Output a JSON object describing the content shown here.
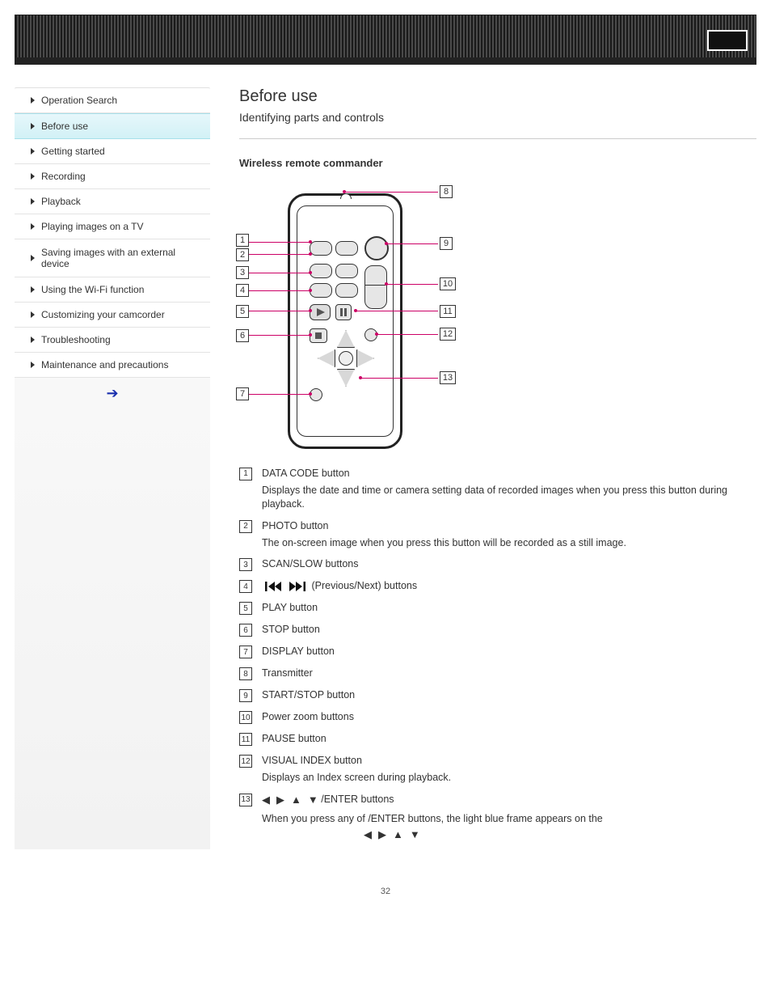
{
  "header": {
    "title": ""
  },
  "sidebar": {
    "items": [
      {
        "label": "Operation Search"
      },
      {
        "label": "Before use"
      },
      {
        "label": "Getting started"
      },
      {
        "label": "Recording"
      },
      {
        "label": "Playback"
      },
      {
        "label": "Playing images on a TV"
      },
      {
        "label": "Saving images with an external device"
      },
      {
        "label": "Using the Wi-Fi function"
      },
      {
        "label": "Customizing your camcorder"
      },
      {
        "label": "Troubleshooting"
      },
      {
        "label": "Maintenance and precautions"
      }
    ],
    "selected_index": 1
  },
  "main": {
    "title": "Before use",
    "subtitle": "Identifying parts and controls",
    "section": "Wireless remote commander",
    "items": {
      "1": {
        "text": "DATA CODE button",
        "note": "Displays the date and time or camera setting data of recorded images when you press this button during playback."
      },
      "2": {
        "text": "PHOTO button",
        "note": "The on-screen image when you press this button will be recorded as a still image."
      },
      "3": {
        "text": "SCAN/SLOW buttons"
      },
      "4": {
        "prefix": "",
        "text": "(Previous/Next) buttons"
      },
      "5": {
        "text": "PLAY button"
      },
      "6": {
        "text": "STOP button"
      },
      "7": {
        "text": "DISPLAY button"
      },
      "8": {
        "text": "Transmitter"
      },
      "9": {
        "text": "START/STOP button"
      },
      "10": {
        "text": "Power zoom buttons"
      },
      "11": {
        "text": "PAUSE button"
      },
      "12": {
        "text": "VISUAL INDEX button",
        "note": "Displays an Index screen during playback."
      },
      "13": {
        "text": "/ENTER buttons",
        "note": "When you press any of          /ENTER buttons, the light blue frame appears on the"
      }
    }
  },
  "page_number": "32"
}
